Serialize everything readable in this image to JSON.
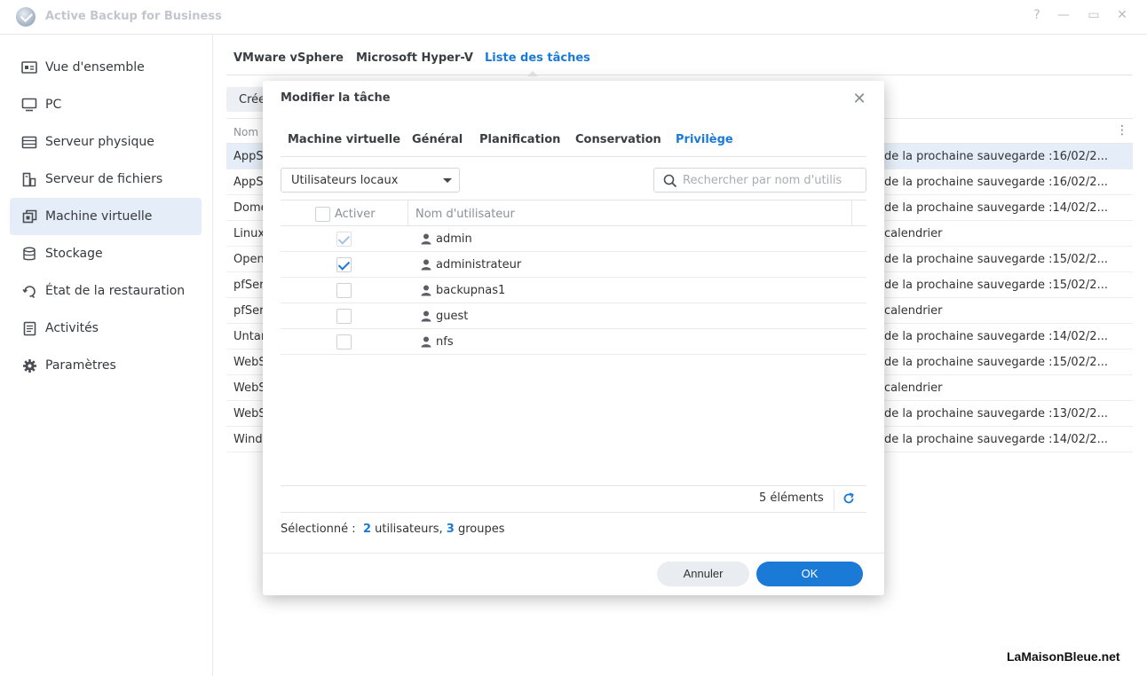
{
  "window": {
    "title": "Active Backup for Business",
    "controls": [
      "?",
      "—",
      "▭",
      "✕"
    ]
  },
  "sidebar": {
    "items": [
      {
        "label": "Vue d'ensemble",
        "icon": "overview-icon"
      },
      {
        "label": "PC",
        "icon": "monitor-icon"
      },
      {
        "label": "Serveur physique",
        "icon": "server-icon"
      },
      {
        "label": "Serveur de fichiers",
        "icon": "file-server-icon"
      },
      {
        "label": "Machine virtuelle",
        "icon": "virtual-machine-icon",
        "active": true
      },
      {
        "label": "Stockage",
        "icon": "database-icon"
      },
      {
        "label": "État de la restauration",
        "icon": "restore-icon"
      },
      {
        "label": "Activités",
        "icon": "activity-log-icon"
      },
      {
        "label": "Paramètres",
        "icon": "gear-icon"
      }
    ]
  },
  "main": {
    "tabs": [
      {
        "label": "VMware vSphere"
      },
      {
        "label": "Microsoft Hyper-V"
      },
      {
        "label": "Liste des tâches",
        "active": true
      }
    ],
    "create_label": "Crée",
    "table": {
      "header_name": "Nom",
      "rows": [
        {
          "name": "AppS",
          "next": "de la prochaine sauvegarde :16/02/2...",
          "selected": true
        },
        {
          "name": "AppS",
          "next": "de la prochaine sauvegarde :16/02/2..."
        },
        {
          "name": "Dome",
          "next": "de la prochaine sauvegarde :14/02/2..."
        },
        {
          "name": "Linux",
          "next": "calendrier"
        },
        {
          "name": "Open",
          "next": "de la prochaine sauvegarde :15/02/2..."
        },
        {
          "name": "pfSer",
          "next": "de la prochaine sauvegarde :15/02/2..."
        },
        {
          "name": "pfSer",
          "next": "calendrier"
        },
        {
          "name": "Untar",
          "next": "de la prochaine sauvegarde :14/02/2..."
        },
        {
          "name": "WebS",
          "next": "de la prochaine sauvegarde :15/02/2..."
        },
        {
          "name": "WebS",
          "next": "calendrier"
        },
        {
          "name": "WebS",
          "next": "de la prochaine sauvegarde :13/02/2..."
        },
        {
          "name": "Wind",
          "next": "de la prochaine sauvegarde :14/02/2..."
        }
      ]
    }
  },
  "modal": {
    "title": "Modifier la tâche",
    "tabs": [
      {
        "label": "Machine virtuelle"
      },
      {
        "label": "Général"
      },
      {
        "label": "Planification"
      },
      {
        "label": "Conservation"
      },
      {
        "label": "Privilège",
        "active": true
      }
    ],
    "user_type_select": "Utilisateurs locaux",
    "search_placeholder": "Rechercher par nom d'utilis",
    "table": {
      "col_enable": "Activer",
      "col_username": "Nom d'utilisateur",
      "rows": [
        {
          "name": "admin",
          "checked": true,
          "disabled": true
        },
        {
          "name": "administrateur",
          "checked": true,
          "disabled": false
        },
        {
          "name": "backupnas1",
          "checked": false,
          "disabled": false
        },
        {
          "name": "guest",
          "checked": false,
          "disabled": false
        },
        {
          "name": "nfs",
          "checked": false,
          "disabled": false
        }
      ]
    },
    "item_count": "5 éléments",
    "selected": {
      "prefix": "Sélectionné :",
      "users_count": "2",
      "users_label": "utilisateurs,",
      "groups_count": "3",
      "groups_label": "groupes"
    },
    "cancel_label": "Annuler",
    "ok_label": "OK"
  },
  "watermark": "LaMaisonBleue.net",
  "colors": {
    "accent": "#1a7ad6",
    "selected_row": "#e4edf8"
  }
}
